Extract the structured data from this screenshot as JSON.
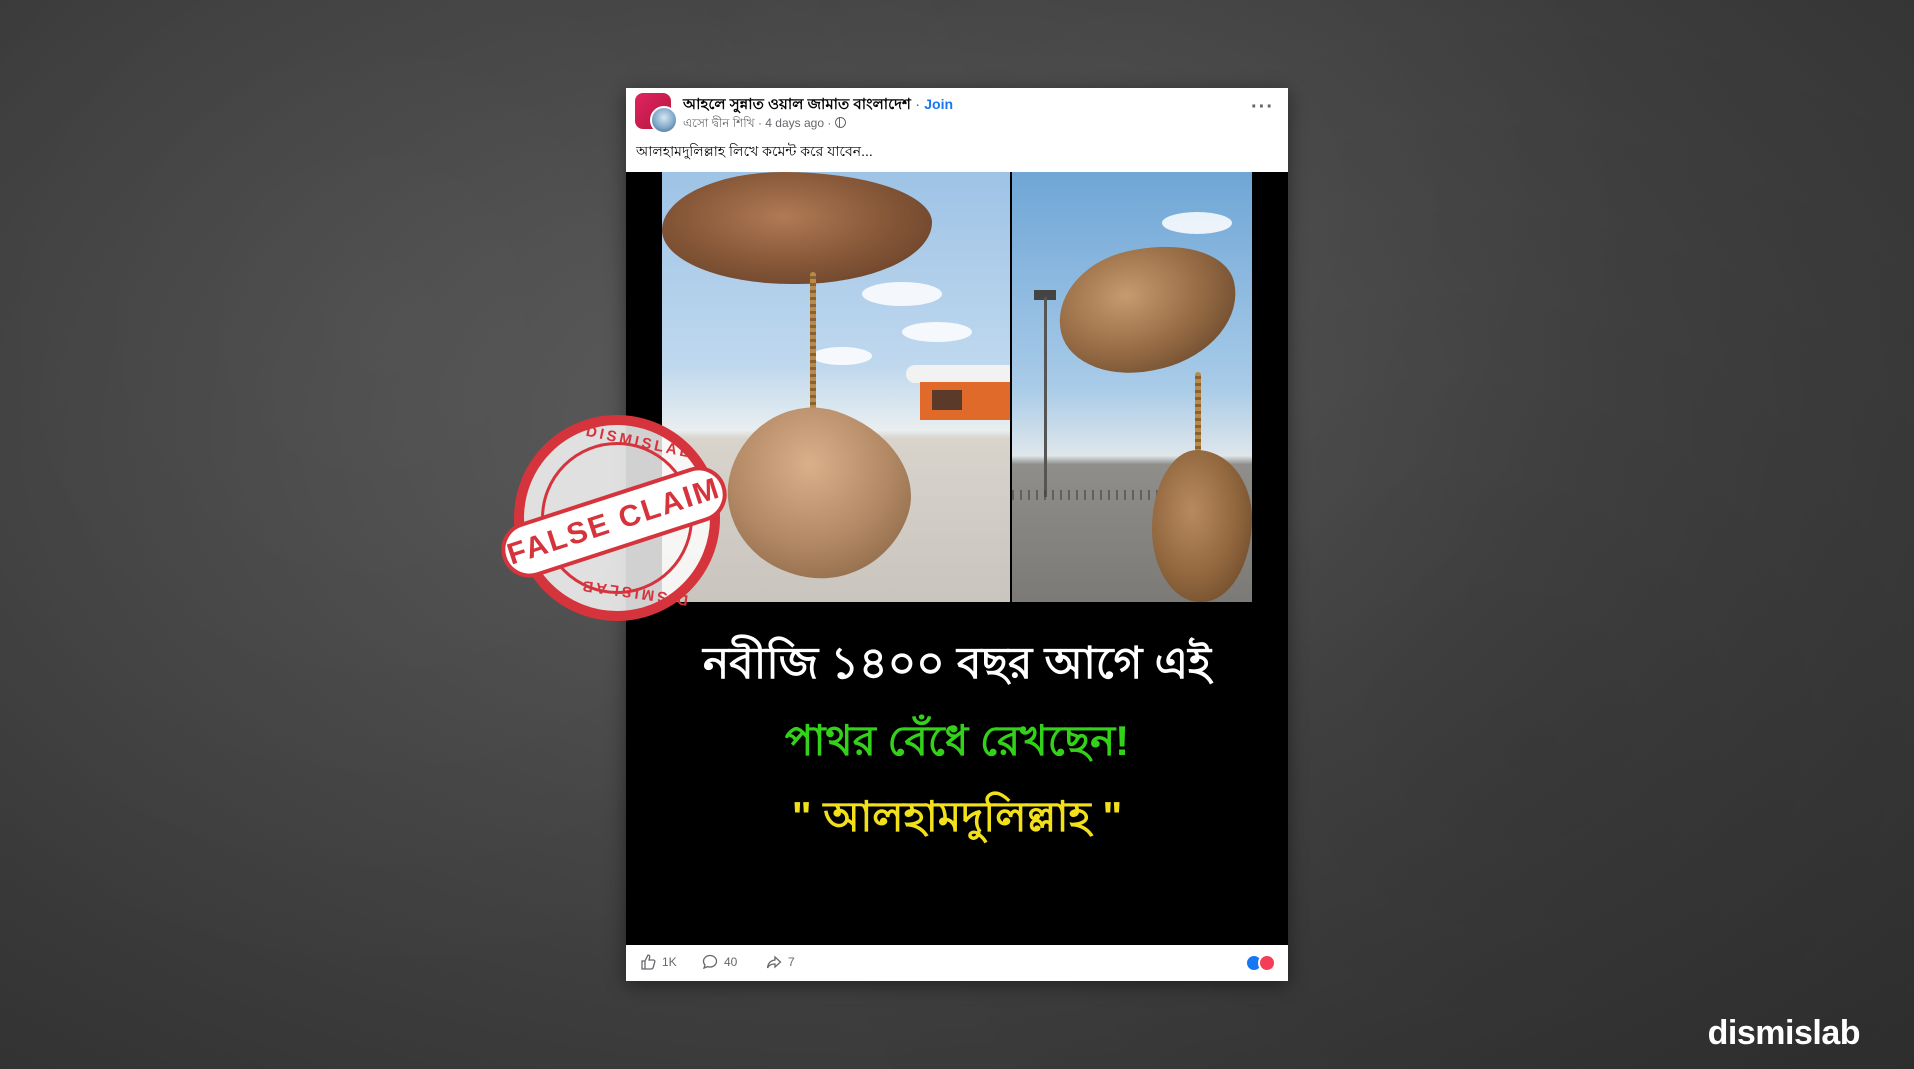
{
  "post": {
    "group_name": "আহলে সুন্নাত ওয়াল জামাত বাংলাদেশ",
    "join_label": "Join",
    "author": "এসো দ্বীন শিখি",
    "time": "4 days ago",
    "caption": "আলহামদুলিল্লাহ লিখে কমেন্ট করে যাবেন...",
    "more_label": "···",
    "image_text": {
      "line1": "নবীজি ১৪০০ বছর আগে এই",
      "line2": "পাথর বেঁধে রেখছেন!",
      "line3": "\" আলহামদুলিল্লাহ \""
    },
    "footer": {
      "likes": "1K",
      "comments": "40",
      "shares": "7"
    }
  },
  "stamp": {
    "label": "FALSE CLAIM",
    "arc_top": "DISMISLAB",
    "arc_bottom": "DISMISLAB"
  },
  "brand": {
    "logo_text": "dismislab"
  },
  "colors": {
    "background": "#474747",
    "stamp_red": "#d5343c",
    "line2_green": "#33d11a",
    "line3_yellow": "#f2e01a",
    "join_blue": "#1877f2"
  },
  "icons": [
    "like-icon",
    "comment-icon",
    "share-icon",
    "globe-icon",
    "more-icon"
  ]
}
